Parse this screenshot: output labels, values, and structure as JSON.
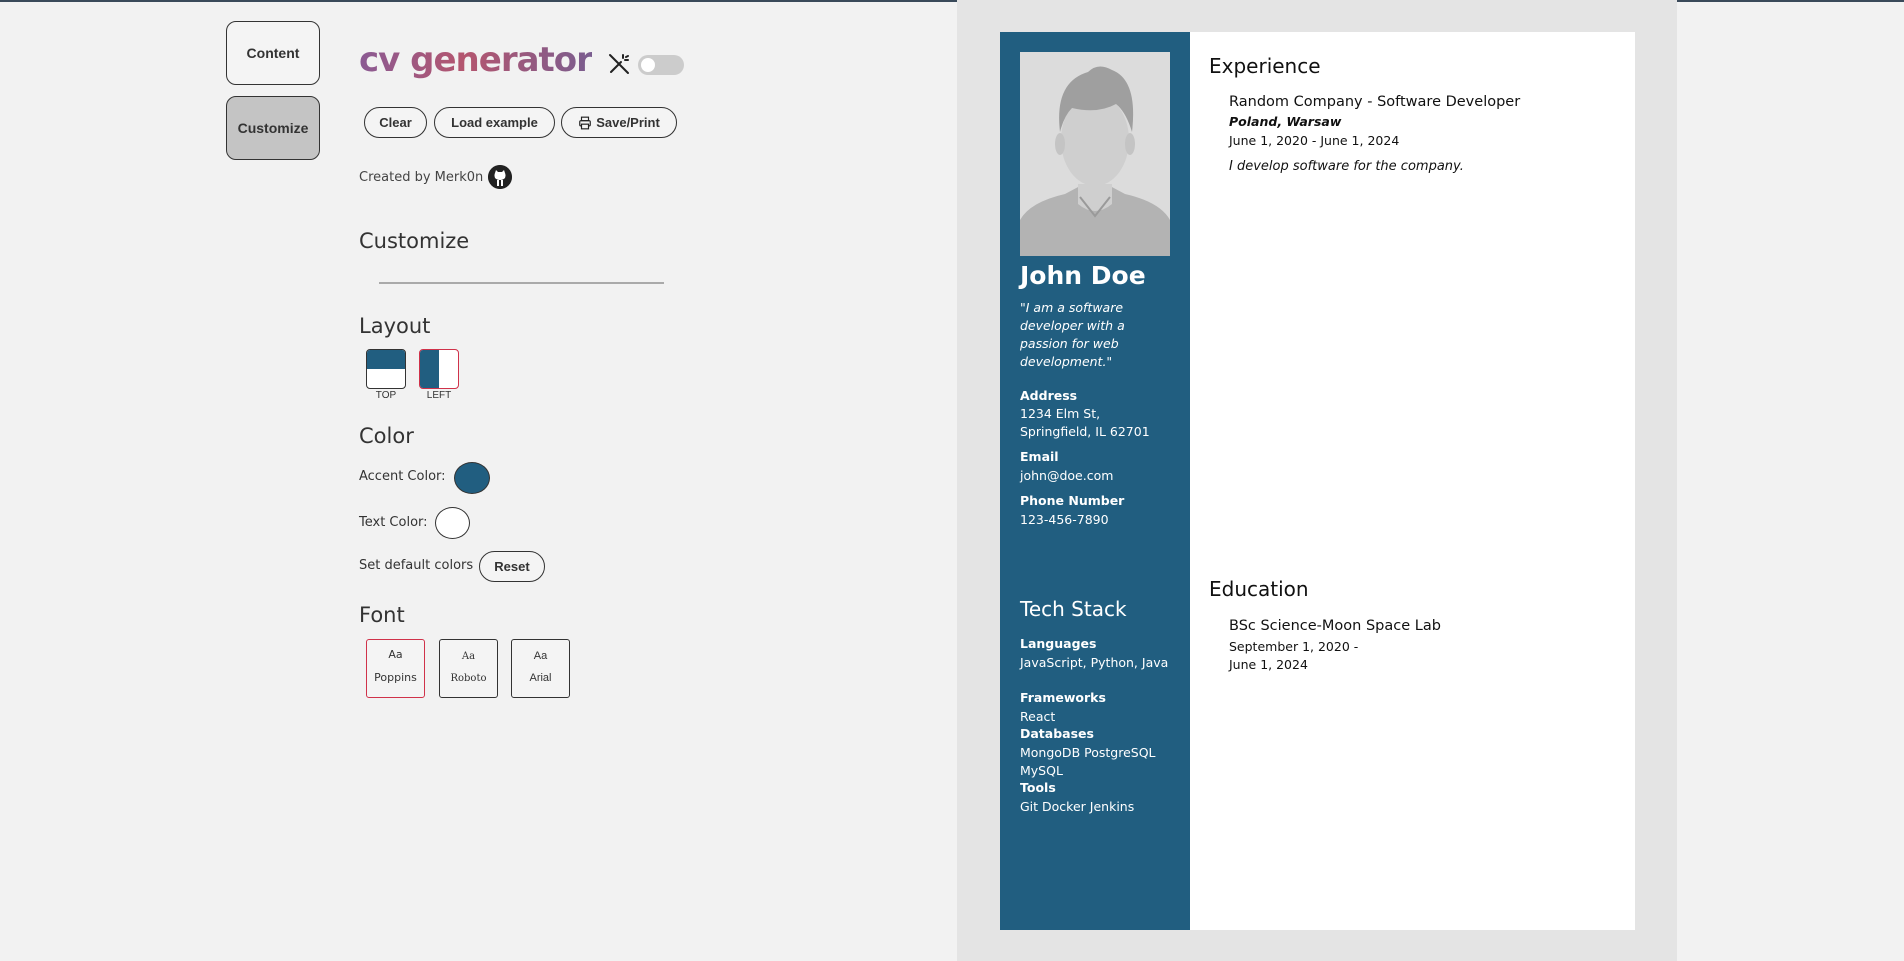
{
  "nav": {
    "content_label": "Content",
    "customize_label": "Customize"
  },
  "header": {
    "title": "cv generator",
    "theme_icon": "magic-wand-off-icon",
    "theme_toggle_on": false
  },
  "actions": {
    "clear_label": "Clear",
    "load_example_label": "Load example",
    "save_print_label": "Save/Print",
    "print_icon": "printer-icon"
  },
  "credit": {
    "text": "Created by Merk0n",
    "icon": "github-icon"
  },
  "customize": {
    "heading": "Customize",
    "layout": {
      "heading": "Layout",
      "options": [
        "TOP",
        "LEFT"
      ],
      "selected": "LEFT"
    },
    "color": {
      "heading": "Color",
      "accent_label": "Accent Color:",
      "accent_color": "#215e80",
      "text_label": "Text Color:",
      "text_color": "#ffffff",
      "default_label": "Set default colors",
      "reset_label": "Reset"
    },
    "font": {
      "heading": "Font",
      "sample": "Aa",
      "options": [
        "Poppins",
        "Roboto",
        "Arial"
      ],
      "selected": "Poppins"
    }
  },
  "cv": {
    "name": "John Doe",
    "summary": "\"I am a software developer with a passion for web development.\"",
    "address_label": "Address",
    "address": "1234 Elm St, Springfield, IL 62701",
    "email_label": "Email",
    "email": "john@doe.com",
    "phone_label": "Phone Number",
    "phone": "123-456-7890",
    "tech_heading": "Tech Stack",
    "tech": [
      {
        "label": "Languages",
        "value": "JavaScript, Python, Java"
      },
      {
        "label": "Frameworks",
        "value": "React"
      },
      {
        "label": "Databases",
        "value": "MongoDB PostgreSQL MySQL"
      },
      {
        "label": "Tools",
        "value": "Git Docker Jenkins"
      }
    ],
    "experience_heading": "Experience",
    "experience": {
      "role": "Random Company - Software Developer",
      "location": "Poland, Warsaw",
      "dates": "June 1, 2020 - June 1, 2024",
      "description": "I develop software for the company."
    },
    "education_heading": "Education",
    "education": {
      "degree": "BSc Science-Moon Space Lab",
      "dates": "September 1, 2020 - June 1, 2024"
    }
  }
}
